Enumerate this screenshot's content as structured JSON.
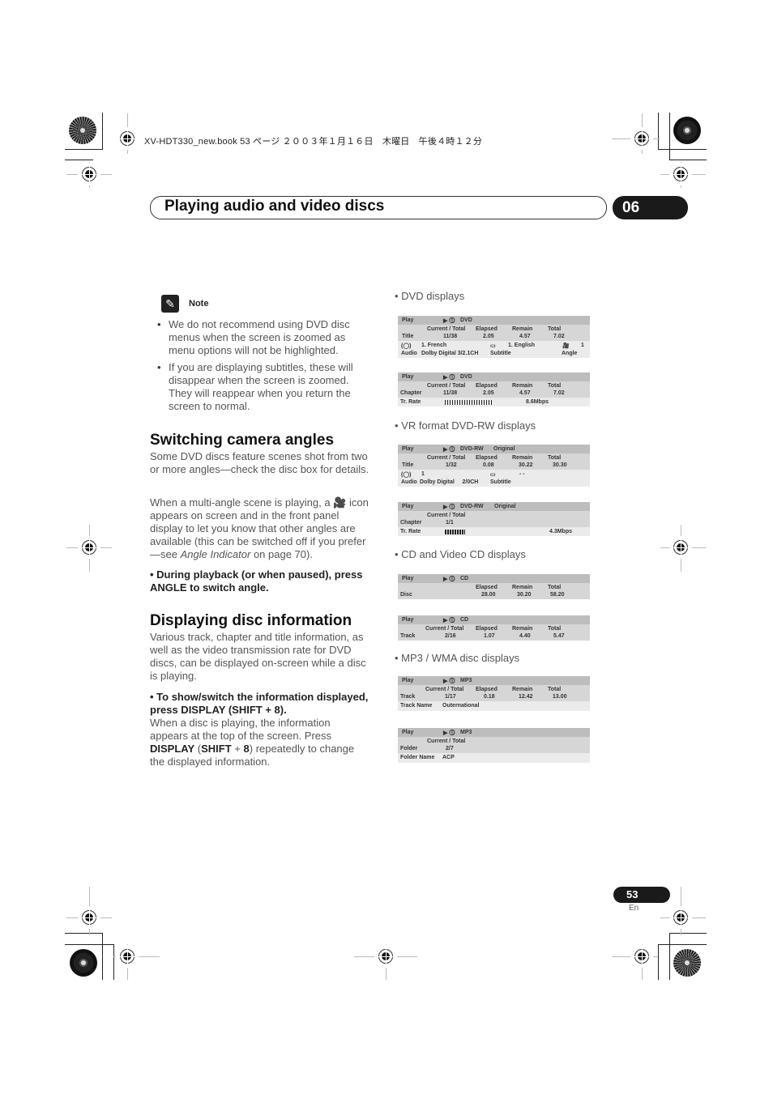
{
  "slug": "XV-HDT330_new.book  53 ページ  ２００３年１月１６日　木曜日　午後４時１２分",
  "header": {
    "title": "Playing audio and video discs",
    "chapter": "06"
  },
  "note": {
    "icon": "pencil-icon",
    "label": "Note",
    "items": [
      "We do not recommend using DVD disc menus when the screen is zoomed as menu options will not be highlighted.",
      "If you are displaying subtitles, these will disappear when the screen is zoomed. They will reappear when you return the screen to normal."
    ]
  },
  "angles": {
    "heading": "Switching camera angles",
    "p1": "Some DVD discs feature scenes shot from two or more angles—check the disc box for details.",
    "p2_a": "When a multi-angle scene is playing, a",
    "p2_icon": "camera-angle-icon",
    "p2_b": "icon appears on screen and in the front panel display to let you know that other angles are available (this can be switched off if you prefer—see",
    "p2_ref": "Angle Indicator",
    "p2_c": "on page 70).",
    "step": "•    During playback (or when paused), press ANGLE to switch angle."
  },
  "info": {
    "heading": "Displaying disc information",
    "p1": "Various track, chapter and title information, as well as the video transmission rate for DVD discs, can be displayed on-screen while a disc is playing.",
    "step": "•    To show/switch the information displayed, press DISPLAY (SHIFT + 8).",
    "p2_a": "When a disc is playing, the information appears at the top of the screen. Press",
    "p2_b1": "DISPLAY",
    "p2_b2": "SHIFT",
    "p2_b3": "8",
    "p2_c": "repeatedly to change the displayed information."
  },
  "displays": {
    "dvd_head": "• DVD displays",
    "vr_head": "• VR format DVD-RW displays",
    "cd_head": "• CD and Video CD displays",
    "mp3_head": "• MP3 / WMA disc displays",
    "common": {
      "play": "Play",
      "cur_total": "Current / Total",
      "elapsed": "Elapsed",
      "remain": "Remain",
      "total": "Total",
      "tr_rate": "Tr. Rate"
    },
    "dvd1": {
      "disc": "DVD",
      "label": "Title",
      "cur": "11/38",
      "elapsed": "2.05",
      "remain": "4.57",
      "total": "7.02",
      "audio_val": "1. French",
      "audio_label": "Audio",
      "audio_fmt": "Dolby Digital 3/2.1CH",
      "sub_val": "1. English",
      "sub_label": "Subtitle",
      "angle_val": "1",
      "angle_label": "Angle"
    },
    "dvd2": {
      "disc": "DVD",
      "label": "Chapter",
      "cur": "11/38",
      "elapsed": "2.05",
      "remain": "4.57",
      "total": "7.02",
      "rate": "8.6Mbps"
    },
    "vr1": {
      "disc": "DVD-RW",
      "mode": "Original",
      "label": "Title",
      "cur": "1/32",
      "elapsed": "0.08",
      "remain": "30.22",
      "total": "30.30",
      "audio_val": "1",
      "audio_label": "Audio",
      "audio_fmt": "Dolby Digital     2/0CH",
      "sub_val": "- -",
      "sub_label": "Subtitle"
    },
    "vr2": {
      "disc": "DVD-RW",
      "mode": "Original",
      "label": "Chapter",
      "cur": "1/1",
      "rate": "4.3Mbps"
    },
    "cd1": {
      "disc": "CD",
      "label": "Disc",
      "elapsed": "28.00",
      "remain": "30.20",
      "total": "58.20"
    },
    "cd2": {
      "disc": "CD",
      "label": "Track",
      "cur": "2/16",
      "elapsed": "1.07",
      "remain": "4.40",
      "total": "5.47"
    },
    "mp1": {
      "disc": "MP3",
      "label": "Track",
      "cur": "1/17",
      "elapsed": "0.18",
      "remain": "12.42",
      "total": "13.00",
      "name_label": "Track Name",
      "name_val": "Outernational"
    },
    "mp2": {
      "disc": "MP3",
      "label": "Folder",
      "cur": "2/7",
      "name_label": "Folder Name",
      "name_val": "ACP"
    }
  },
  "footer": {
    "page": "53",
    "lang": "En"
  }
}
